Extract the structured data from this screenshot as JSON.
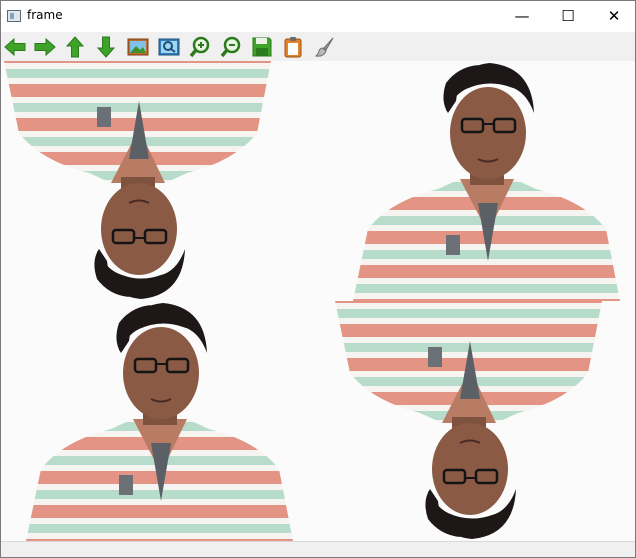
{
  "window": {
    "title": "frame",
    "controls": {
      "minimize": "—",
      "maximize": "☐",
      "close": "✕"
    }
  },
  "toolbar": {
    "tools": [
      {
        "name": "pan-left",
        "icon": "arrow-left-icon"
      },
      {
        "name": "pan-right",
        "icon": "arrow-right-icon"
      },
      {
        "name": "pan-up",
        "icon": "arrow-up-icon"
      },
      {
        "name": "pan-down",
        "icon": "arrow-down-icon"
      },
      {
        "name": "zoom-fit",
        "icon": "image-icon"
      },
      {
        "name": "zoom-original",
        "icon": "zoom-original-icon"
      },
      {
        "name": "zoom-in",
        "icon": "zoom-in-icon"
      },
      {
        "name": "zoom-out",
        "icon": "zoom-out-icon"
      },
      {
        "name": "save-image",
        "icon": "save-icon"
      },
      {
        "name": "copy-image",
        "icon": "clipboard-icon"
      },
      {
        "name": "properties",
        "icon": "brush-icon"
      }
    ]
  },
  "image": {
    "quadrants": [
      {
        "position": "top-left",
        "orientation": "flipped-vertical"
      },
      {
        "position": "top-right",
        "orientation": "original"
      },
      {
        "position": "bottom-left",
        "orientation": "original"
      },
      {
        "position": "bottom-right",
        "orientation": "flipped-vertical"
      }
    ]
  },
  "colors": {
    "toolbar_icon_green": "#3fa32a",
    "shirt_coral": "#e49484",
    "shirt_mint": "#b8dccb",
    "shirt_white": "#f6f4f1",
    "skin": "#8a5a45",
    "hair": "#1d1717",
    "background": "#fbfbfb"
  },
  "statusbar": {
    "text": ""
  }
}
